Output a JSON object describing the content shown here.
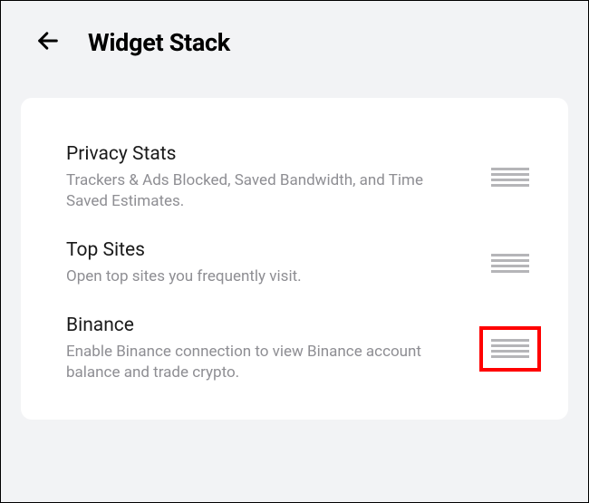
{
  "header": {
    "title": "Widget Stack"
  },
  "items": [
    {
      "title": "Privacy Stats",
      "subtitle": "Trackers & Ads Blocked, Saved Bandwidth, and Time Saved Estimates.",
      "highlighted": false
    },
    {
      "title": "Top Sites",
      "subtitle": "Open top sites you frequently visit.",
      "highlighted": false
    },
    {
      "title": "Binance",
      "subtitle": "Enable Binance connection to view Binance account balance and trade crypto.",
      "highlighted": true
    }
  ]
}
